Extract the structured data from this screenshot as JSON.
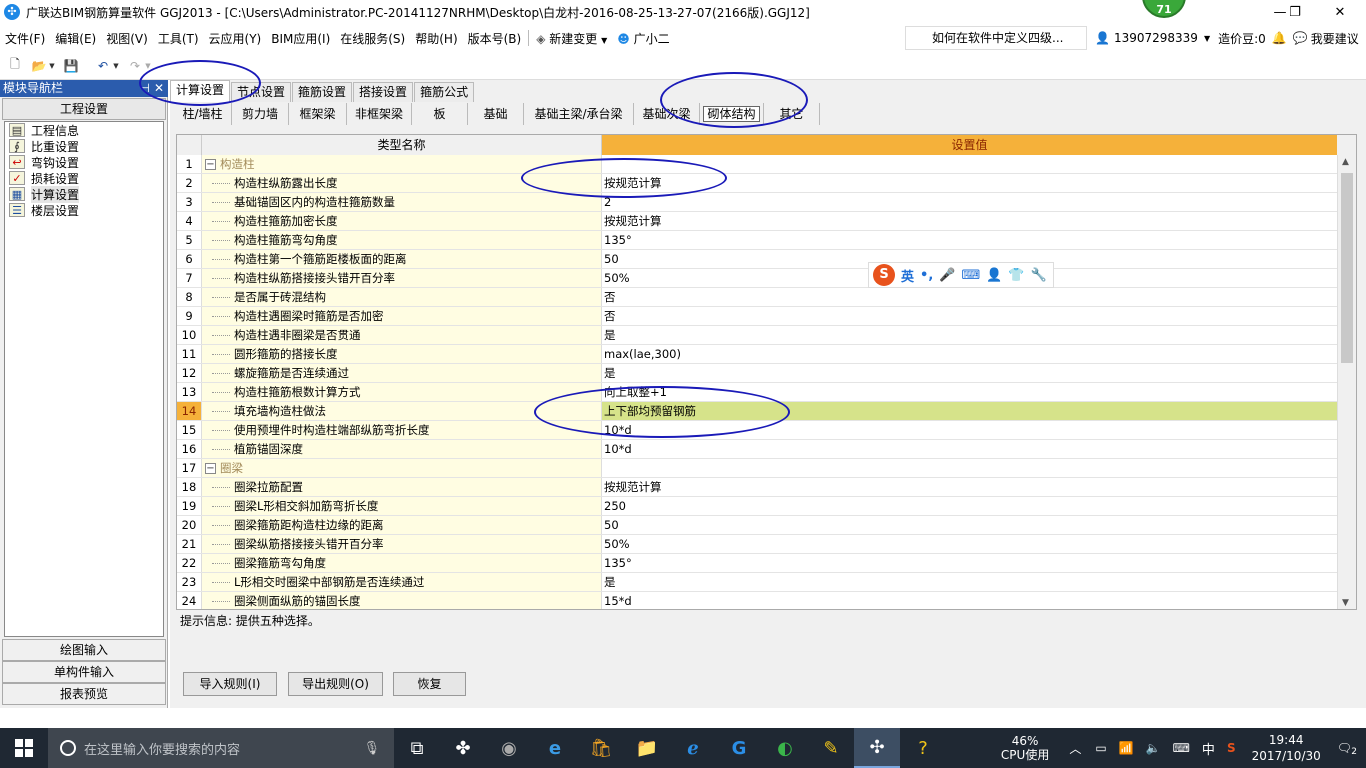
{
  "window": {
    "title": "广联达BIM钢筋算量软件 GGJ2013 - [C:\\Users\\Administrator.PC-20141127NRHM\\Desktop\\白龙村-2016-08-25-13-27-07(2166版).GGJ12]",
    "badge": "71",
    "controls": [
      "—",
      "❐",
      "✕"
    ]
  },
  "menu": {
    "items": [
      "文件(F)",
      "编辑(E)",
      "视图(V)",
      "工具(T)",
      "云应用(Y)",
      "BIM应用(I)",
      "在线服务(S)",
      "帮助(H)",
      "版本号(B)"
    ],
    "new_change": "新建变更",
    "assistant": "广小二",
    "help_query": "如何在软件中定义四级...",
    "phone": "13907298339",
    "cost_bean": "造价豆:0",
    "suggest": "我要建议"
  },
  "nav": {
    "header": "模块导航栏",
    "title": "工程设置",
    "items": [
      "工程信息",
      "比重设置",
      "弯钩设置",
      "损耗设置",
      "计算设置",
      "楼层设置"
    ],
    "selected": "计算设置",
    "bottom_buttons": [
      "绘图输入",
      "单构件输入",
      "报表预览"
    ]
  },
  "tabs_top": {
    "items": [
      "计算设置",
      "节点设置",
      "箍筋设置",
      "搭接设置",
      "箍筋公式"
    ],
    "active": "计算设置"
  },
  "tabs_sub": {
    "items": [
      "柱/墙柱",
      "剪力墙",
      "框架梁",
      "非框架梁",
      "板",
      "基础",
      "基础主梁/承台梁",
      "基础次梁",
      "砌体结构",
      "其它"
    ],
    "active": "砌体结构"
  },
  "grid": {
    "col_name": "类型名称",
    "col_value": "设置值",
    "selected_row": "14",
    "rows": [
      {
        "no": "1",
        "name": "构造柱",
        "value": "",
        "group": true
      },
      {
        "no": "2",
        "name": "构造柱纵筋露出长度",
        "value": "按规范计算"
      },
      {
        "no": "3",
        "name": "基础锚固区内的构造柱箍筋数量",
        "value": "2"
      },
      {
        "no": "4",
        "name": "构造柱箍筋加密长度",
        "value": "按规范计算"
      },
      {
        "no": "5",
        "name": "构造柱箍筋弯勾角度",
        "value": "135°"
      },
      {
        "no": "6",
        "name": "构造柱第一个箍筋距楼板面的距离",
        "value": "50"
      },
      {
        "no": "7",
        "name": "构造柱纵筋搭接接头错开百分率",
        "value": "50%"
      },
      {
        "no": "8",
        "name": "是否属于砖混结构",
        "value": "否"
      },
      {
        "no": "9",
        "name": "构造柱遇圈梁时箍筋是否加密",
        "value": "否"
      },
      {
        "no": "10",
        "name": "构造柱遇非圈梁是否贯通",
        "value": "是"
      },
      {
        "no": "11",
        "name": "圆形箍筋的搭接长度",
        "value": "max(lae,300)"
      },
      {
        "no": "12",
        "name": "螺旋箍筋是否连续通过",
        "value": "是"
      },
      {
        "no": "13",
        "name": "构造柱箍筋根数计算方式",
        "value": "向上取整+1"
      },
      {
        "no": "14",
        "name": "填充墙构造柱做法",
        "value": "上下部均预留钢筋"
      },
      {
        "no": "15",
        "name": "使用预埋件时构造柱端部纵筋弯折长度",
        "value": "10*d"
      },
      {
        "no": "16",
        "name": "植筋锚固深度",
        "value": "10*d"
      },
      {
        "no": "17",
        "name": "圈梁",
        "value": "",
        "group": true
      },
      {
        "no": "18",
        "name": "圈梁拉筋配置",
        "value": "按规范计算"
      },
      {
        "no": "19",
        "name": "圈梁L形相交斜加筋弯折长度",
        "value": "250"
      },
      {
        "no": "20",
        "name": "圈梁箍筋距构造柱边缘的距离",
        "value": "50"
      },
      {
        "no": "21",
        "name": "圈梁纵筋搭接接头错开百分率",
        "value": "50%"
      },
      {
        "no": "22",
        "name": "圈梁箍筋弯勾角度",
        "value": "135°"
      },
      {
        "no": "23",
        "name": "L形相交时圈梁中部钢筋是否连续通过",
        "value": "是"
      },
      {
        "no": "24",
        "name": "圈梁侧面纵筋的锚固长度",
        "value": "15*d"
      }
    ]
  },
  "hint": "提示信息: 提供五种选择。",
  "buttons": {
    "import": "导入规则(I)",
    "export": "导出规则(O)",
    "restore": "恢复"
  },
  "ime": {
    "lang": "英",
    "logo": "S"
  },
  "taskbar": {
    "search_placeholder": "在这里输入你要搜索的内容",
    "cpu_percent": "46%",
    "cpu_label": "CPU使用",
    "ime_lang": "中",
    "time": "19:44",
    "date": "2017/10/30",
    "notifications": "2"
  },
  "colors": {
    "header_value": "#f5b13a",
    "selected_value": "#d6e38a",
    "name_col": "#fffde2",
    "annotation": "#1a1ab8"
  }
}
